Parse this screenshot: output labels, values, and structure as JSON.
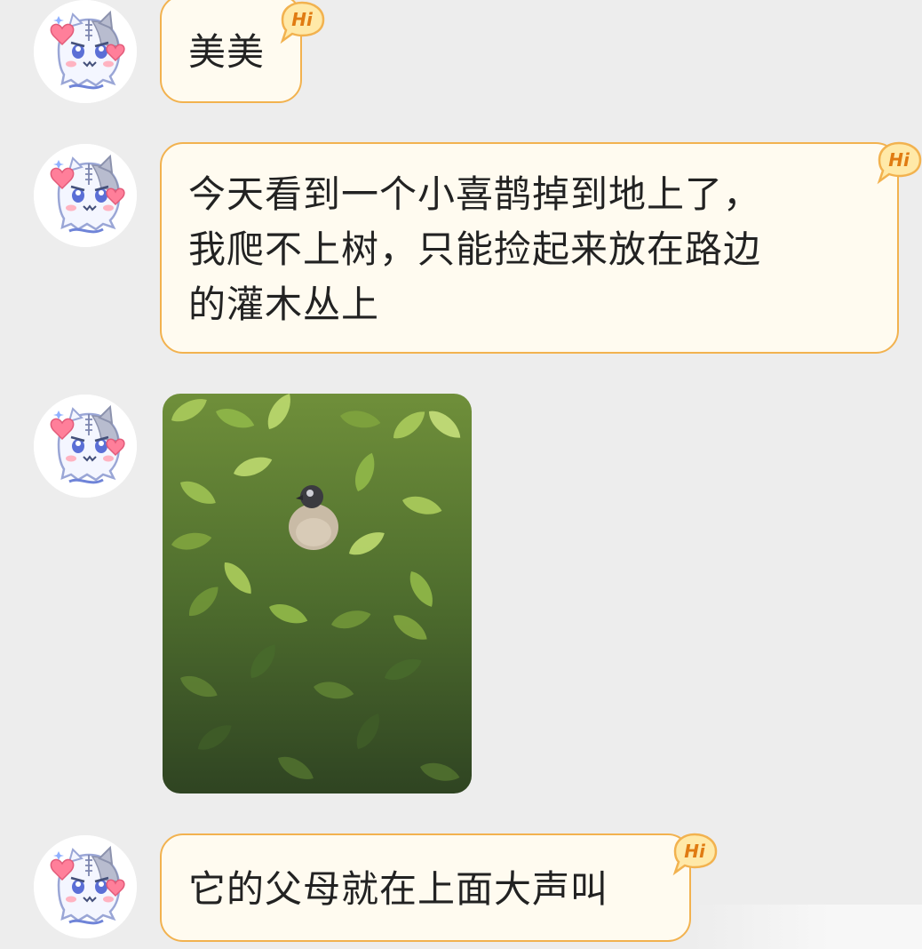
{
  "chat": {
    "messages": [
      {
        "type": "text",
        "text": "美美"
      },
      {
        "type": "text",
        "text": "今天看到一个小喜鹊掉到地上了，\n我爬不上树，只能捡起来放在路边\n的灌木丛上"
      },
      {
        "type": "image"
      },
      {
        "type": "text",
        "text": "它的父母就在上面大声叫"
      }
    ],
    "badge_text": "Hi",
    "avatar_icon": "ghost-cat-avatar-icon"
  },
  "colors": {
    "background": "#ededed",
    "bubble_fill": "#fffbf0",
    "bubble_border": "#f2b24f",
    "badge_fill": "#ffe9a8",
    "badge_text": "#e07b12"
  }
}
